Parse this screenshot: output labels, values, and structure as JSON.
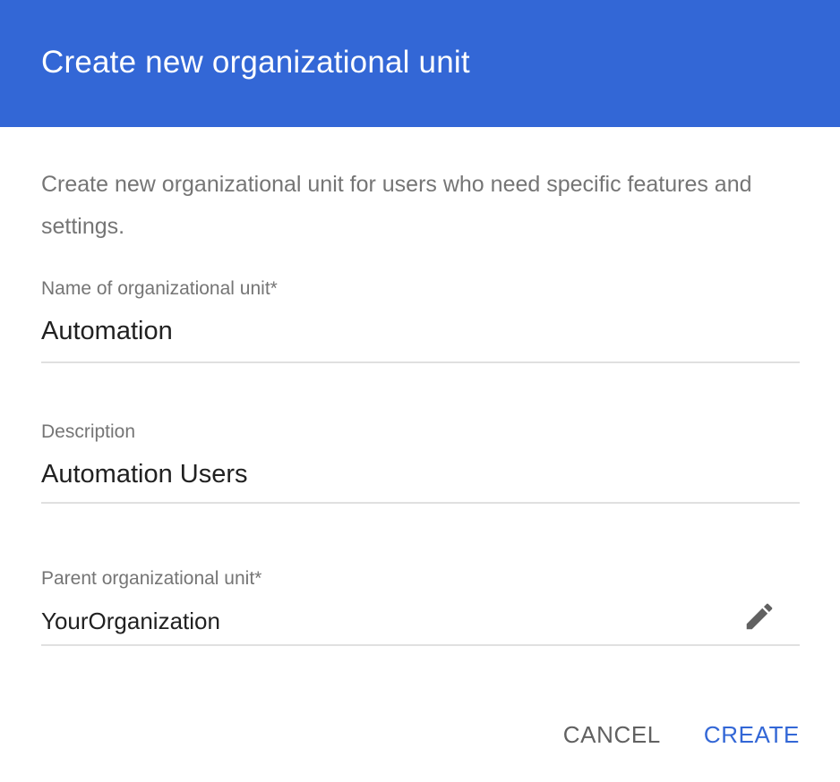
{
  "dialog": {
    "title": "Create new organizational unit",
    "description": "Create new organizational unit for users who need specific features and settings."
  },
  "fields": {
    "name": {
      "label": "Name of organizational unit*",
      "value": "Automation"
    },
    "description": {
      "label": "Description",
      "value": "Automation Users"
    },
    "parent": {
      "label": "Parent organizational unit*",
      "value": "YourOrganization",
      "icon": "pencil-icon"
    }
  },
  "actions": {
    "cancel_label": "CANCEL",
    "create_label": "CREATE"
  },
  "colors": {
    "header_bg": "#3367d6",
    "primary_action": "#3367d6",
    "label_text": "#757575",
    "value_text": "#212121",
    "divider": "#e0e0e0"
  }
}
